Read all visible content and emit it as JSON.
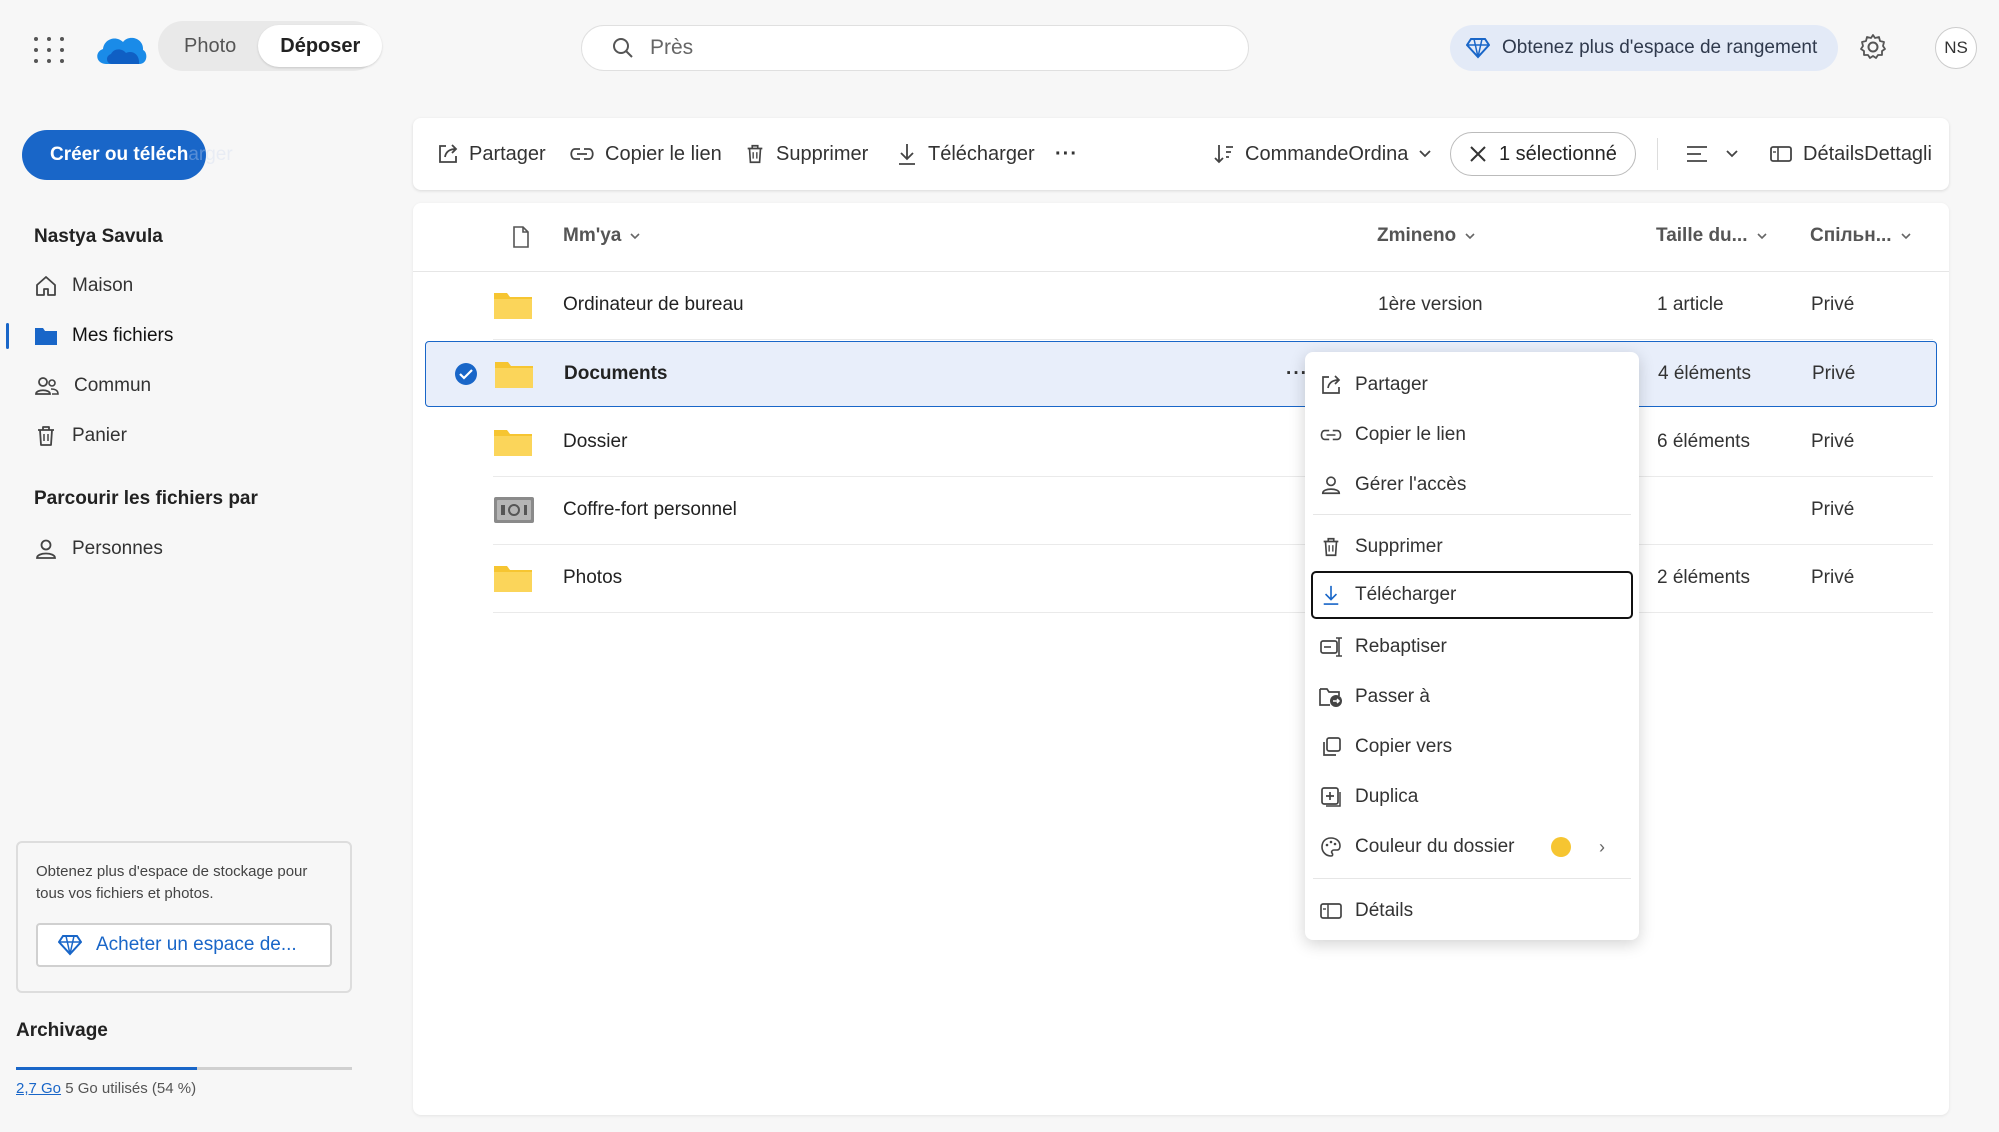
{
  "topbar": {
    "app_tabs": [
      {
        "label": "Photo"
      },
      {
        "label": "Déposer"
      }
    ],
    "search_placeholder": "Près",
    "promo_label": "Obtenez plus d'espace de rangement",
    "avatar_initials": "NS"
  },
  "sidebar": {
    "create_label": "Créer ou téléch",
    "create_label_faded": "arger",
    "user_name": "Nastya Savula",
    "items": [
      {
        "label": "Maison",
        "icon": "home-icon"
      },
      {
        "label": "Mes fichiers",
        "icon": "folder-icon",
        "selected": true
      },
      {
        "label": "Commun",
        "icon": "people-icon"
      },
      {
        "label": "Panier",
        "icon": "trash-icon"
      }
    ],
    "browse_heading": "Parcourir les fichiers par",
    "browse_items": [
      {
        "label": "Personnes",
        "icon": "person-icon"
      }
    ],
    "storage_card_text": "Obtenez plus d'espace de stockage pour tous vos fichiers et photos.",
    "buy_label": "Acheter un espace de...",
    "storage_heading": "Archivage",
    "usage_link": "2,7 Go",
    "usage_text": "5 Go utilisés (54 %)",
    "usage_fraction": 0.54
  },
  "toolbar": {
    "share": "Partager",
    "copy_link": "Copier le lien",
    "delete": "Supprimer",
    "download": "Télécharger",
    "more": "···",
    "sort": "CommandeOrdina",
    "selected": "1 sélectionné",
    "details": "DétailsDettagli"
  },
  "columns": {
    "name": "Mm'ya",
    "modified": "Zmineno",
    "size": "Taille du...",
    "sharing": "Спільн..."
  },
  "files": [
    {
      "name": "Ordinateur de bureau",
      "modified": "1ère version",
      "size": "1 article",
      "sharing": "Privé",
      "type": "folder"
    },
    {
      "name": "Documents",
      "modified": "",
      "size": "4 éléments",
      "sharing": "Privé",
      "type": "folder",
      "selected": true
    },
    {
      "name": "Dossier",
      "modified": "",
      "size": "6 éléments",
      "sharing": "Privé",
      "type": "folder"
    },
    {
      "name": "Coffre-fort personnel",
      "modified": "",
      "size": "",
      "sharing": "Privé",
      "type": "vault"
    },
    {
      "name": "Photos",
      "modified": "",
      "size": "2 éléments",
      "sharing": "Privé",
      "type": "folder"
    }
  ],
  "row_more": "···",
  "context_menu": {
    "items": [
      {
        "label": "Partager"
      },
      {
        "label": "Copier le lien"
      },
      {
        "label": "Gérer l'accès"
      },
      {
        "label": "Supprimer"
      },
      {
        "label": "Télécharger",
        "focused": true
      },
      {
        "label": "Rebaptiser"
      },
      {
        "label": "Passer à"
      },
      {
        "label": "Copier vers"
      },
      {
        "label": "Duplica"
      },
      {
        "label": "Couleur du dossier"
      },
      {
        "label": "Détails"
      }
    ],
    "folder_color": "#f6c531",
    "submenu_chevron": "›"
  },
  "colors": {
    "accent": "#1966c8",
    "folder": "#f6c531",
    "selected_row": "#e8eefa"
  }
}
